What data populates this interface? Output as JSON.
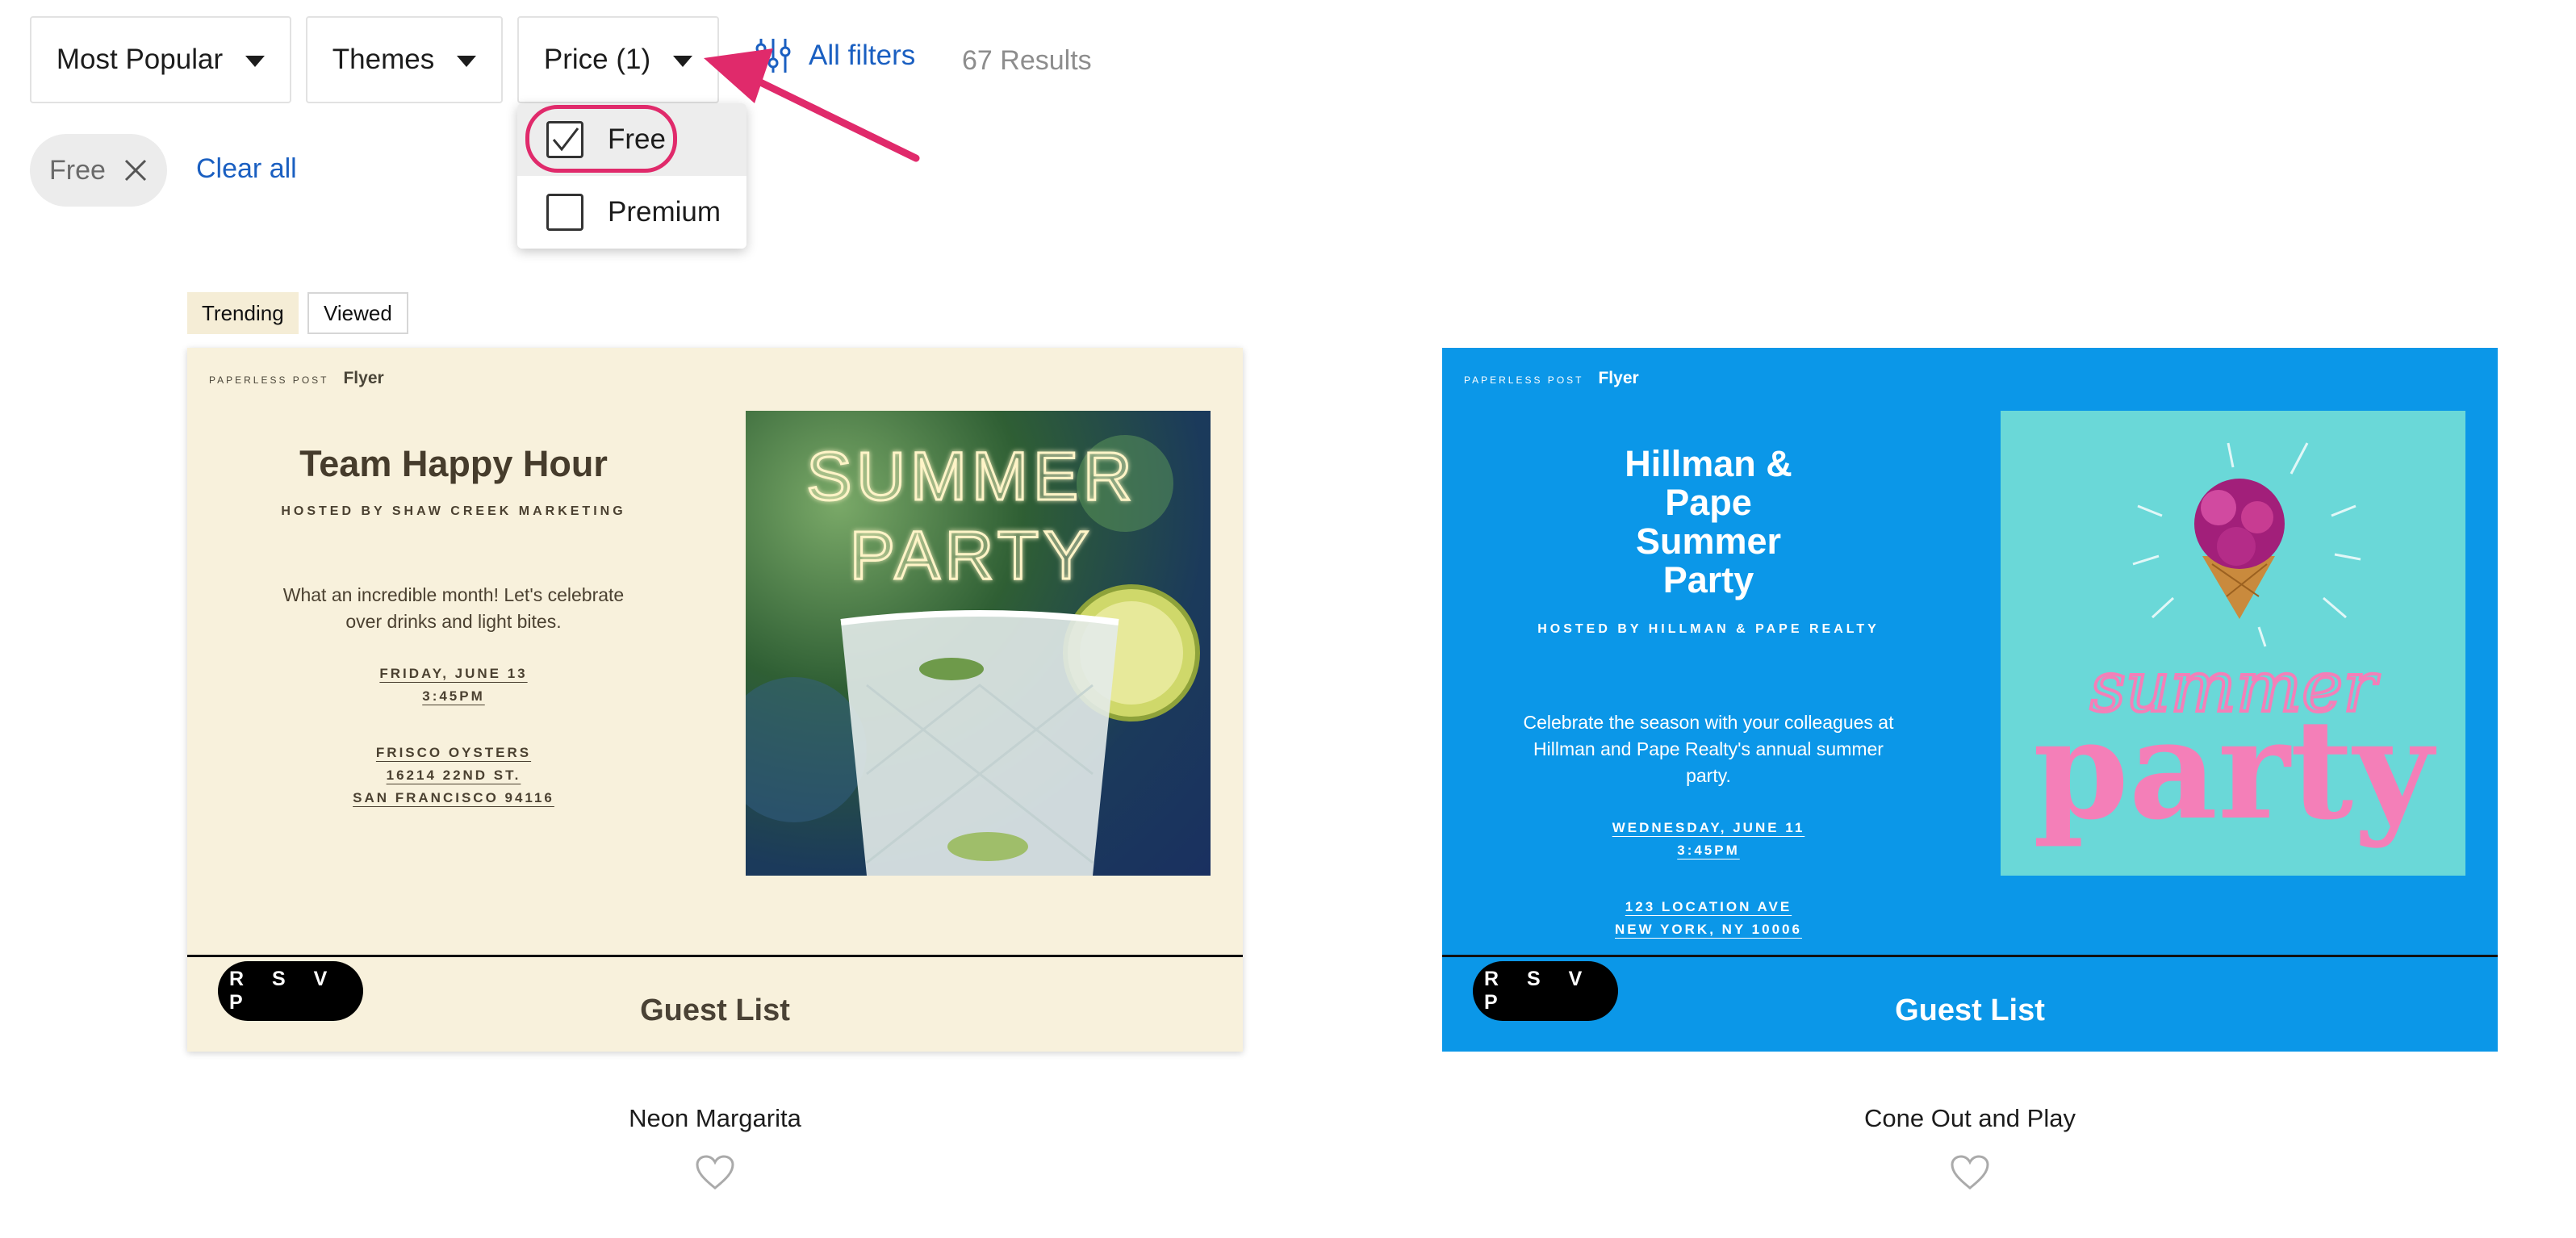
{
  "filter_bar": {
    "sort_label": "Most Popular",
    "themes_label": "Themes",
    "price_label": "Price (1)",
    "all_filters_label": "All filters",
    "results_text": "67 Results"
  },
  "chips": {
    "active_chip": "Free",
    "clear_all": "Clear all"
  },
  "price_dropdown": {
    "options": [
      {
        "label": "Free",
        "checked": true
      },
      {
        "label": "Premium",
        "checked": false
      }
    ]
  },
  "badges": [
    "Trending",
    "Viewed"
  ],
  "cards": [
    {
      "brand_small": "PAPERLESS POST",
      "brand_name": "Flyer",
      "title": "Team Happy Hour",
      "host": "HOSTED BY SHAW CREEK MARKETING",
      "description": "What an incredible month! Let's celebrate over drinks and light bites.",
      "date": "FRIDAY, JUNE 13",
      "time": "3:45PM",
      "address": "FRISCO OYSTERS\n16214 22ND ST.\nSAN FRANCISCO 94116",
      "image_text_1": "SUMMER",
      "image_text_2": "PARTY",
      "rsvp": "R S V P",
      "guest_list": "Guest List",
      "caption": "Neon Margarita",
      "colors": {
        "background": "#f8f1dc",
        "text": "#463c2c"
      }
    },
    {
      "brand_small": "PAPERLESS POST",
      "brand_name": "Flyer",
      "title": "Hillman & Pape Summer Party",
      "host": "HOSTED BY HILLMAN & PAPE REALTY",
      "description": "Celebrate the season with your colleagues at Hillman and Pape Realty's annual summer party.",
      "date": "WEDNESDAY, JUNE 11",
      "time": "3:45PM",
      "address": "123 LOCATION AVE\nNEW YORK, NY 10006",
      "image_text_1": "summer",
      "image_text_2": "party",
      "rsvp": "R S V P",
      "guest_list": "Guest List",
      "caption": "Cone Out and Play",
      "colors": {
        "background": "#0b97e8",
        "text": "#ffffff"
      }
    }
  ],
  "colors": {
    "link": "#1a5fc1",
    "annotation": "#e02a6b",
    "muted_text": "#8d8d8d"
  }
}
